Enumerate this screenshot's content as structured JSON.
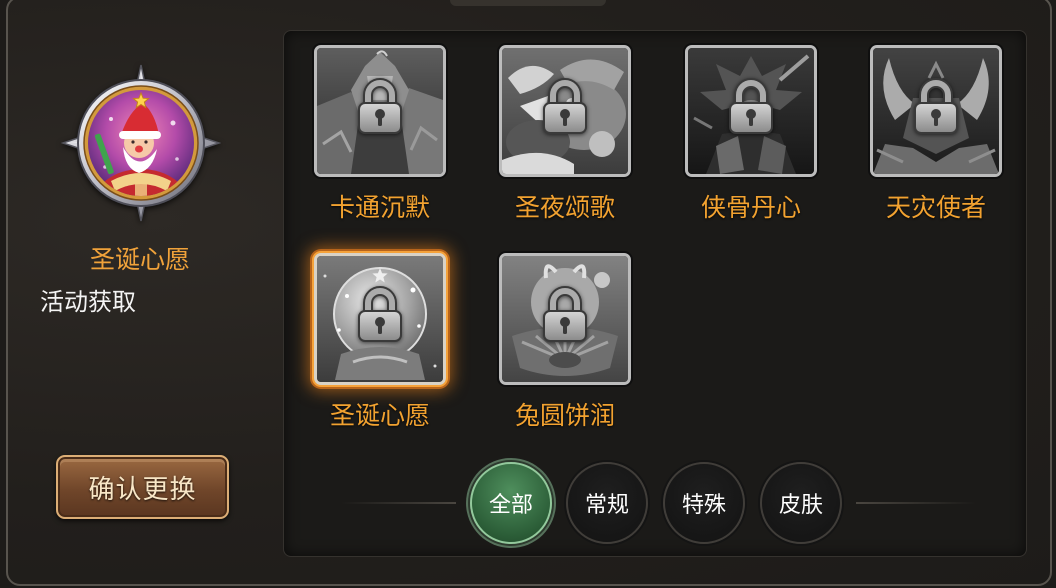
{
  "preview": {
    "name": "圣诞心愿",
    "source": "活动获取",
    "confirm_label": "确认更换",
    "emblem_icon": "santa-orb-emblem"
  },
  "items": [
    {
      "name": "卡通沉默",
      "locked": true,
      "selected": false,
      "icon": "lock-icon"
    },
    {
      "name": "圣夜颂歌",
      "locked": true,
      "selected": false,
      "icon": "lock-icon"
    },
    {
      "name": "侠骨丹心",
      "locked": true,
      "selected": false,
      "icon": "lock-icon"
    },
    {
      "name": "天灾使者",
      "locked": true,
      "selected": false,
      "icon": "lock-icon"
    },
    {
      "name": "圣诞心愿",
      "locked": true,
      "selected": true,
      "icon": "lock-icon"
    },
    {
      "name": "兔圆饼润",
      "locked": true,
      "selected": false,
      "icon": "lock-icon"
    }
  ],
  "filter_tabs": [
    {
      "label": "全部",
      "active": true
    },
    {
      "label": "常规",
      "active": false
    },
    {
      "label": "特殊",
      "active": false
    },
    {
      "label": "皮肤",
      "active": false
    }
  ],
  "colors": {
    "item_label": "#f2a230",
    "preview_name": "#f0a23a",
    "active_tab": "#3d7a4b",
    "selected_glow": "#f5a23a",
    "button_border": "#dcae76"
  }
}
